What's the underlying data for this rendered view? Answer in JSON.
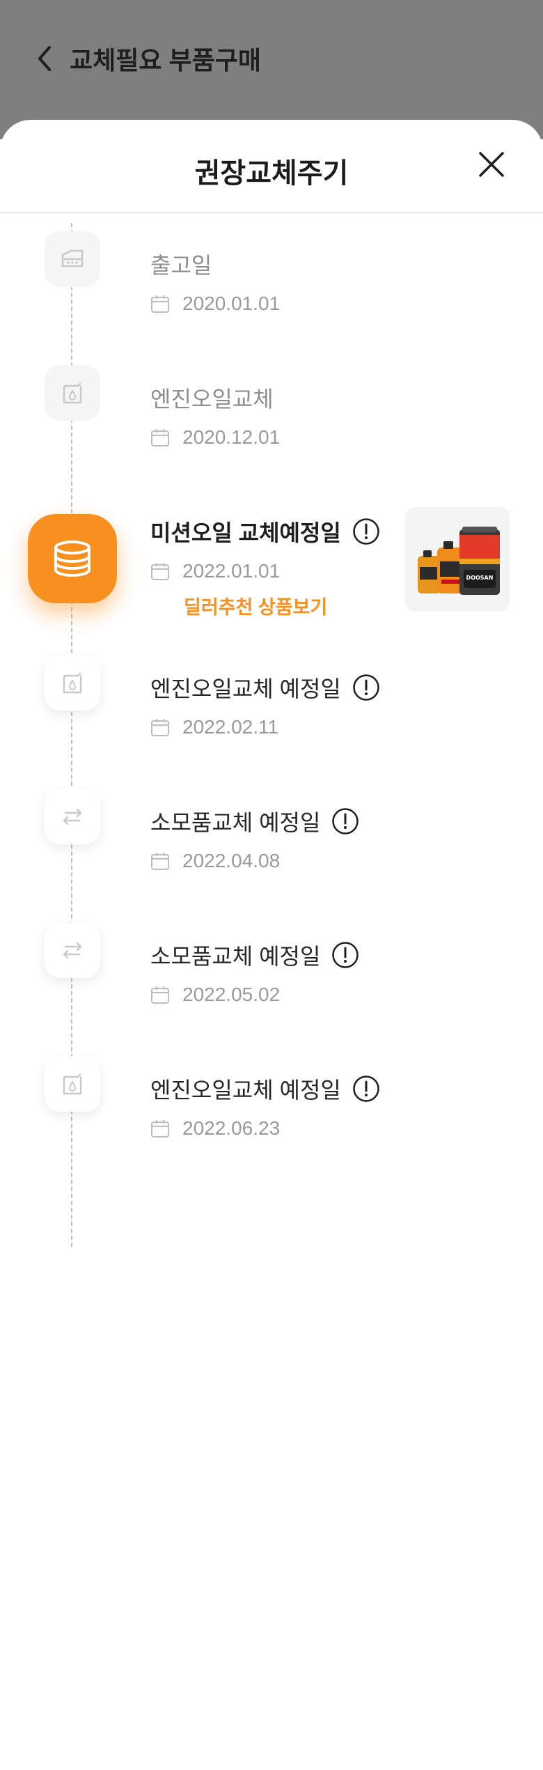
{
  "header": {
    "title": "교체필요 부품구매"
  },
  "sheet": {
    "title": "권장교체주기"
  },
  "timeline": [
    {
      "title": "출고일",
      "date": "2020.01.01",
      "icon": "car-body-icon",
      "state": "past"
    },
    {
      "title": "엔진오일교체",
      "date": "2020.12.01",
      "icon": "oil-can-icon",
      "state": "past"
    },
    {
      "title": "미션오일 교체예정일",
      "date": "2022.01.01",
      "icon": "oil-drum-icon",
      "state": "active",
      "link": "딜러추천 상품보기"
    },
    {
      "title": "엔진오일교체 예정일",
      "date": "2022.02.11",
      "icon": "oil-can-icon",
      "state": "upcoming"
    },
    {
      "title": "소모품교체 예정일",
      "date": "2022.04.08",
      "icon": "swap-arrows-icon",
      "state": "upcoming"
    },
    {
      "title": "소모품교체 예정일",
      "date": "2022.05.02",
      "icon": "swap-arrows-icon",
      "state": "upcoming"
    },
    {
      "title": "엔진오일교체 예정일",
      "date": "2022.06.23",
      "icon": "oil-can-icon",
      "state": "upcoming"
    }
  ],
  "product": {
    "brand": "DOOSAN"
  },
  "colors": {
    "accent": "#f7901e",
    "overlay": "#7f7f7f",
    "muted": "#8e8e8e",
    "dark": "#1e1e1e"
  }
}
